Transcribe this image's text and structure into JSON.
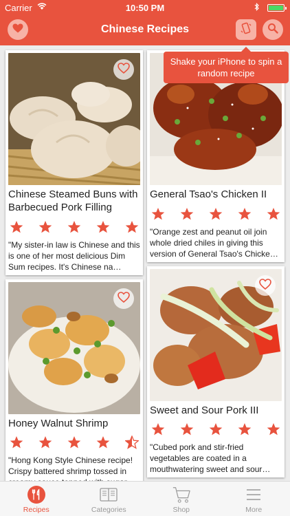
{
  "status_bar": {
    "carrier": "Carrier",
    "time": "10:50 PM",
    "colors": {
      "battery": "#4cd964"
    }
  },
  "nav": {
    "title": "Chinese Recipes",
    "icons": [
      "heart-icon",
      "phone-shake-icon",
      "search-icon"
    ]
  },
  "tooltip": {
    "text": "Shake your iPhone to spin a random recipe"
  },
  "recipes": [
    {
      "name": "Chinese Steamed Buns with Barbecued Pork Filling",
      "rating": 5,
      "description": "\"My sister-in law is Chinese and this is one of her most delicious Dim Sum recipes. It's Chinese na…"
    },
    {
      "name": "General Tsao's Chicken II",
      "rating": 5,
      "description": "\"Orange zest and peanut oil join whole dried chiles in giving this version of General Tsao's Chicke…"
    },
    {
      "name": "Honey Walnut Shrimp",
      "rating": 4.5,
      "description": "\"Hong Kong Style Chinese recipe! Crispy battered shrimp tossed in creamy sauce topped with sugar-…"
    },
    {
      "name": "Sweet and Sour Pork III",
      "rating": 5,
      "description": "\"Cubed pork and stir-fried vegetables are coated in a mouthwatering sweet and sour…"
    }
  ],
  "tabs": [
    {
      "label": "Recipes",
      "icon": "fork-knife-icon",
      "active": true
    },
    {
      "label": "Categories",
      "icon": "book-icon",
      "active": false
    },
    {
      "label": "Shop",
      "icon": "cart-icon",
      "active": false
    },
    {
      "label": "More",
      "icon": "menu-icon",
      "active": false
    }
  ],
  "colors": {
    "accent": "#e8533e",
    "star": "#e8533e"
  }
}
